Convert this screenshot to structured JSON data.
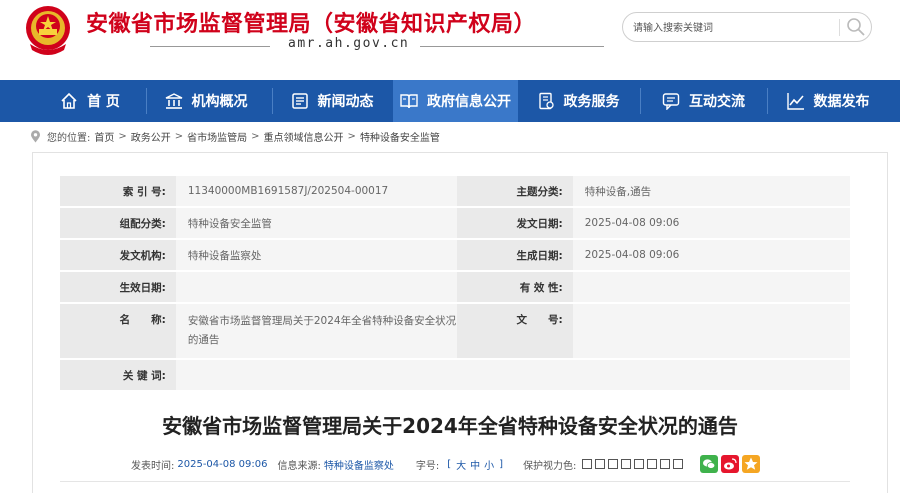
{
  "header": {
    "site_title": "安徽省市场监督管理局（安徽省知识产权局）",
    "site_domain": "amr.ah.gov.cn",
    "search_placeholder": "请输入搜索关键词",
    "brand_red": "#d0021b"
  },
  "nav": {
    "bg_color": "#1c57a7",
    "active_color": "#3a78c9",
    "items": [
      {
        "label": "首 页",
        "icon": "home-icon"
      },
      {
        "label": "机构概况",
        "icon": "institution-icon"
      },
      {
        "label": "新闻动态",
        "icon": "news-icon"
      },
      {
        "label": "政府信息公开",
        "icon": "open-book-icon",
        "active": true
      },
      {
        "label": "政务服务",
        "icon": "service-doc-icon"
      },
      {
        "label": "互动交流",
        "icon": "chat-icon"
      },
      {
        "label": "数据发布",
        "icon": "chart-icon"
      }
    ]
  },
  "breadcrumb": {
    "prefix": "您的位置:",
    "items": [
      "首页",
      "政务公开",
      "省市场监管局",
      "重点领域信息公开",
      "特种设备安全监管"
    ]
  },
  "meta": {
    "index_label": "索 引 号:",
    "index_value": "11340000MB1691587J/202504-00017",
    "topic_label": "主题分类:",
    "topic_value": "特种设备,通告",
    "org_cat_label": "组配分类:",
    "org_cat_value": "特种设备安全监管",
    "pub_date_label": "发文日期:",
    "pub_date_value": "2025-04-08 09:06",
    "issuer_label": "发文机构:",
    "issuer_value": "特种设备监察处",
    "gen_date_label": "生成日期:",
    "gen_date_value": "2025-04-08 09:06",
    "effective_label": "生效日期:",
    "effective_value": "",
    "validity_label": "有 效 性:",
    "validity_value": "",
    "name_label": "名　　称:",
    "name_value": "安徽省市场监督管理局关于2024年全省特种设备安全状况的通告",
    "docno_label": "文　　号:",
    "docno_value": "",
    "keywords_label": "关 键 词:",
    "keywords_value": ""
  },
  "article": {
    "title": "安徽省市场监督管理局关于2024年全省特种设备安全状况的通告",
    "publish_time_label": "发表时间:",
    "publish_time": "2025-04-08 09:06",
    "source_label": "信息来源:",
    "source": "特种设备监察处",
    "font_size_label": "字号:",
    "size_open": "[",
    "size_large": "大",
    "size_medium": "中",
    "size_small": "小",
    "size_close": "]",
    "eye_label": "保护视力色:",
    "share_icons": [
      {
        "icon": "wechat-icon",
        "color": "#3fb24c"
      },
      {
        "icon": "weibo-icon",
        "color": "#e6162d"
      },
      {
        "icon": "qzone-icon",
        "color": "#f5a623"
      }
    ]
  }
}
